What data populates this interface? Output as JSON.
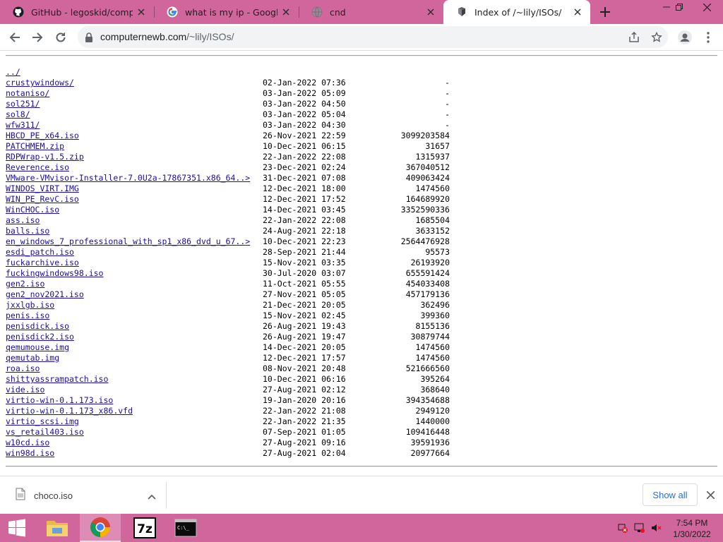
{
  "tabs": [
    {
      "title": "GitHub - legoskid/compile",
      "icon": "github-icon"
    },
    {
      "title": "what is my ip - Google Sea",
      "icon": "google-icon"
    },
    {
      "title": "cnd",
      "icon": "globe-icon"
    },
    {
      "title": "Index of /~lily/ISOs/",
      "icon": "page-icon",
      "active": true
    }
  ],
  "address_bar": {
    "host": "computernewb.com",
    "path": "/~lily/ISOs/"
  },
  "listing": [
    {
      "name": "../",
      "date": "",
      "size": ""
    },
    {
      "name": "crustywindows/",
      "date": "02-Jan-2022 07:36",
      "size": "-"
    },
    {
      "name": "notaniso/",
      "date": "03-Jan-2022 05:09",
      "size": "-"
    },
    {
      "name": "sol251/",
      "date": "03-Jan-2022 04:50",
      "size": "-"
    },
    {
      "name": "sol8/",
      "date": "03-Jan-2022 05:04",
      "size": "-"
    },
    {
      "name": "wfw311/",
      "date": "03-Jan-2022 04:30",
      "size": "-"
    },
    {
      "name": "HBCD_PE_x64.iso",
      "date": "26-Nov-2021 22:59",
      "size": "3099203584"
    },
    {
      "name": "PATCHMEM.zip",
      "date": "10-Dec-2021 06:15",
      "size": "31657"
    },
    {
      "name": "RDPWrap-v1.5.zip",
      "date": "22-Jan-2022 22:08",
      "size": "1315937"
    },
    {
      "name": "Reverence.iso",
      "date": "23-Dec-2021 02:24",
      "size": "367040512"
    },
    {
      "name": "VMware-VMvisor-Installer-7.0U2a-17867351.x86_64..>",
      "date": "31-Dec-2021 07:08",
      "size": "409063424"
    },
    {
      "name": "WINDOS_VIRT.IMG",
      "date": "12-Dec-2021 18:00",
      "size": "1474560"
    },
    {
      "name": "WIN_PE_RevC.iso",
      "date": "12-Dec-2021 17:52",
      "size": "164689920"
    },
    {
      "name": "WinCHOC.iso",
      "date": "14-Dec-2021 03:45",
      "size": "3352590336"
    },
    {
      "name": "ass.iso",
      "date": "22-Jan-2022 22:08",
      "size": "1685504"
    },
    {
      "name": "balls.iso",
      "date": "24-Aug-2021 22:18",
      "size": "3633152"
    },
    {
      "name": "en_windows_7_professional_with_sp1_x86_dvd_u_67..>",
      "date": "10-Dec-2021 22:23",
      "size": "2564476928"
    },
    {
      "name": "esdi_patch.iso",
      "date": "28-Sep-2021 21:44",
      "size": "95573"
    },
    {
      "name": "fuckarchive.iso",
      "date": "15-Nov-2021 03:35",
      "size": "26193920"
    },
    {
      "name": "fuckingwindows98.iso",
      "date": "30-Jul-2020 03:07",
      "size": "655591424"
    },
    {
      "name": "gen2.iso",
      "date": "11-Oct-2021 05:55",
      "size": "454033408"
    },
    {
      "name": "gen2_nov2021.iso",
      "date": "27-Nov-2021 05:05",
      "size": "457179136"
    },
    {
      "name": "jxxlgb.iso",
      "date": "21-Dec-2021 20:05",
      "size": "362496"
    },
    {
      "name": "penis.iso",
      "date": "15-Nov-2021 02:45",
      "size": "399360"
    },
    {
      "name": "penisdick.iso",
      "date": "26-Aug-2021 19:43",
      "size": "8155136"
    },
    {
      "name": "penisdick2.iso",
      "date": "26-Aug-2021 19:47",
      "size": "30879744"
    },
    {
      "name": "qemumouse.img",
      "date": "14-Dec-2021 20:05",
      "size": "1474560"
    },
    {
      "name": "qemutab.img",
      "date": "12-Dec-2021 17:57",
      "size": "1474560"
    },
    {
      "name": "roa.iso",
      "date": "08-Nov-2021 20:48",
      "size": "521666560"
    },
    {
      "name": "shittyassrampatch.iso",
      "date": "10-Dec-2021 06:16",
      "size": "395264"
    },
    {
      "name": "vide.iso",
      "date": "27-Aug-2021 02:12",
      "size": "368640"
    },
    {
      "name": "virtio-win-0.1.173.iso",
      "date": "19-Jan-2020 20:16",
      "size": "394354688"
    },
    {
      "name": "virtio-win-0.1.173_x86.vfd",
      "date": "22-Jan-2022 21:08",
      "size": "2949120"
    },
    {
      "name": "virtio_scsi.img",
      "date": "22-Jan-2022 21:35",
      "size": "1440000"
    },
    {
      "name": "vs_retail403.iso",
      "date": "07-Sep-2021 01:05",
      "size": "109416448"
    },
    {
      "name": "w10cd.iso",
      "date": "27-Aug-2021 09:16",
      "size": "39591936"
    },
    {
      "name": "win98d.iso",
      "date": "27-Aug-2021 02:04",
      "size": "20977664"
    }
  ],
  "download_shelf": {
    "filename": "choco.iso",
    "show_all_label": "Show all"
  },
  "taskbar": {
    "time": "7:54 PM",
    "date": "1/30/2022"
  },
  "colors": {
    "chrome_frame": "#d0669c",
    "link": "#1a0dab",
    "accent": "#1a73e8"
  }
}
